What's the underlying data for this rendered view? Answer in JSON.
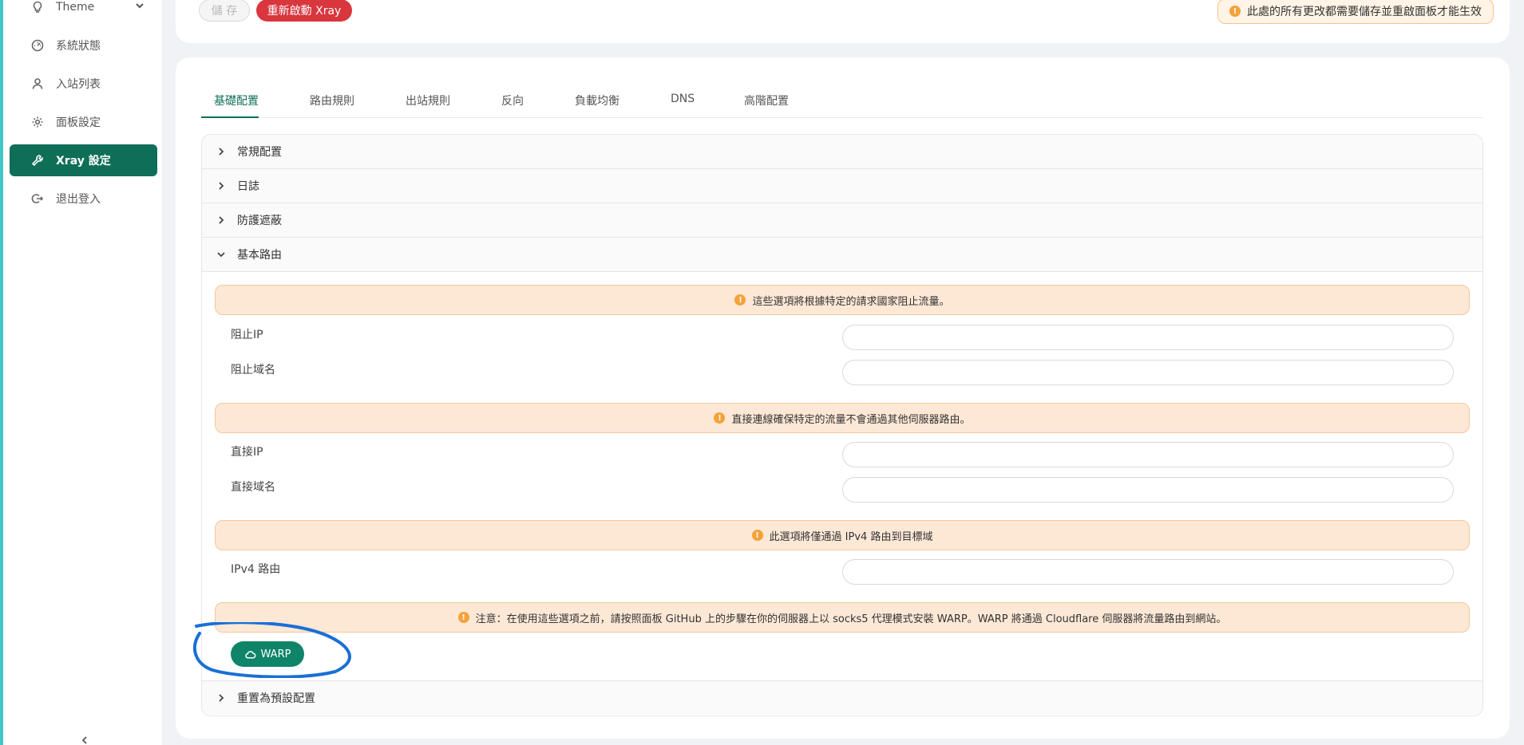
{
  "sidebar": {
    "items": [
      {
        "label": "Theme",
        "icon": "bulb-icon"
      },
      {
        "label": "系統狀態",
        "icon": "dashboard-icon"
      },
      {
        "label": "入站列表",
        "icon": "user-icon"
      },
      {
        "label": "面板設定",
        "icon": "gear-icon"
      },
      {
        "label": "Xray 設定",
        "icon": "wrench-icon"
      },
      {
        "label": "退出登入",
        "icon": "logout-icon"
      }
    ]
  },
  "toolbar": {
    "save_label": "儲 存",
    "restart_label": "重新啟動 Xray",
    "warning": "此處的所有更改都需要儲存並重啟面板才能生效"
  },
  "tabs": [
    {
      "label": "基礎配置"
    },
    {
      "label": "路由規則"
    },
    {
      "label": "出站規則"
    },
    {
      "label": "反向"
    },
    {
      "label": "負載均衡"
    },
    {
      "label": "DNS"
    },
    {
      "label": "高階配置"
    }
  ],
  "panels": {
    "general": "常規配置",
    "log": "日誌",
    "protection": "防護遮蔽",
    "basic_routing": "基本路由",
    "reset": "重置為預設配置"
  },
  "routing": {
    "block_alert": "這些選項將根據特定的請求國家阻止流量。",
    "block_ip_label": "阻止IP",
    "block_domain_label": "阻止域名",
    "direct_alert": "直接連線確保特定的流量不會通過其他伺服器路由。",
    "direct_ip_label": "直接IP",
    "direct_domain_label": "直接域名",
    "ipv4_alert": "此選項將僅通過 IPv4 路由到目標域",
    "ipv4_label": "IPv4 路由",
    "warp_alert": "注意：在使用這些選項之前，請按照面板 GitHub 上的步驟在你的伺服器上以 socks5 代理模式安裝 WARP。WARP 將通過 Cloudflare 伺服器將流量路由到網站。",
    "warp_button": "WARP"
  },
  "colors": {
    "accent": "#0e6e58",
    "danger": "#d9363e",
    "warning_bg": "#fde8d6",
    "annotation": "#1a6fd6"
  }
}
